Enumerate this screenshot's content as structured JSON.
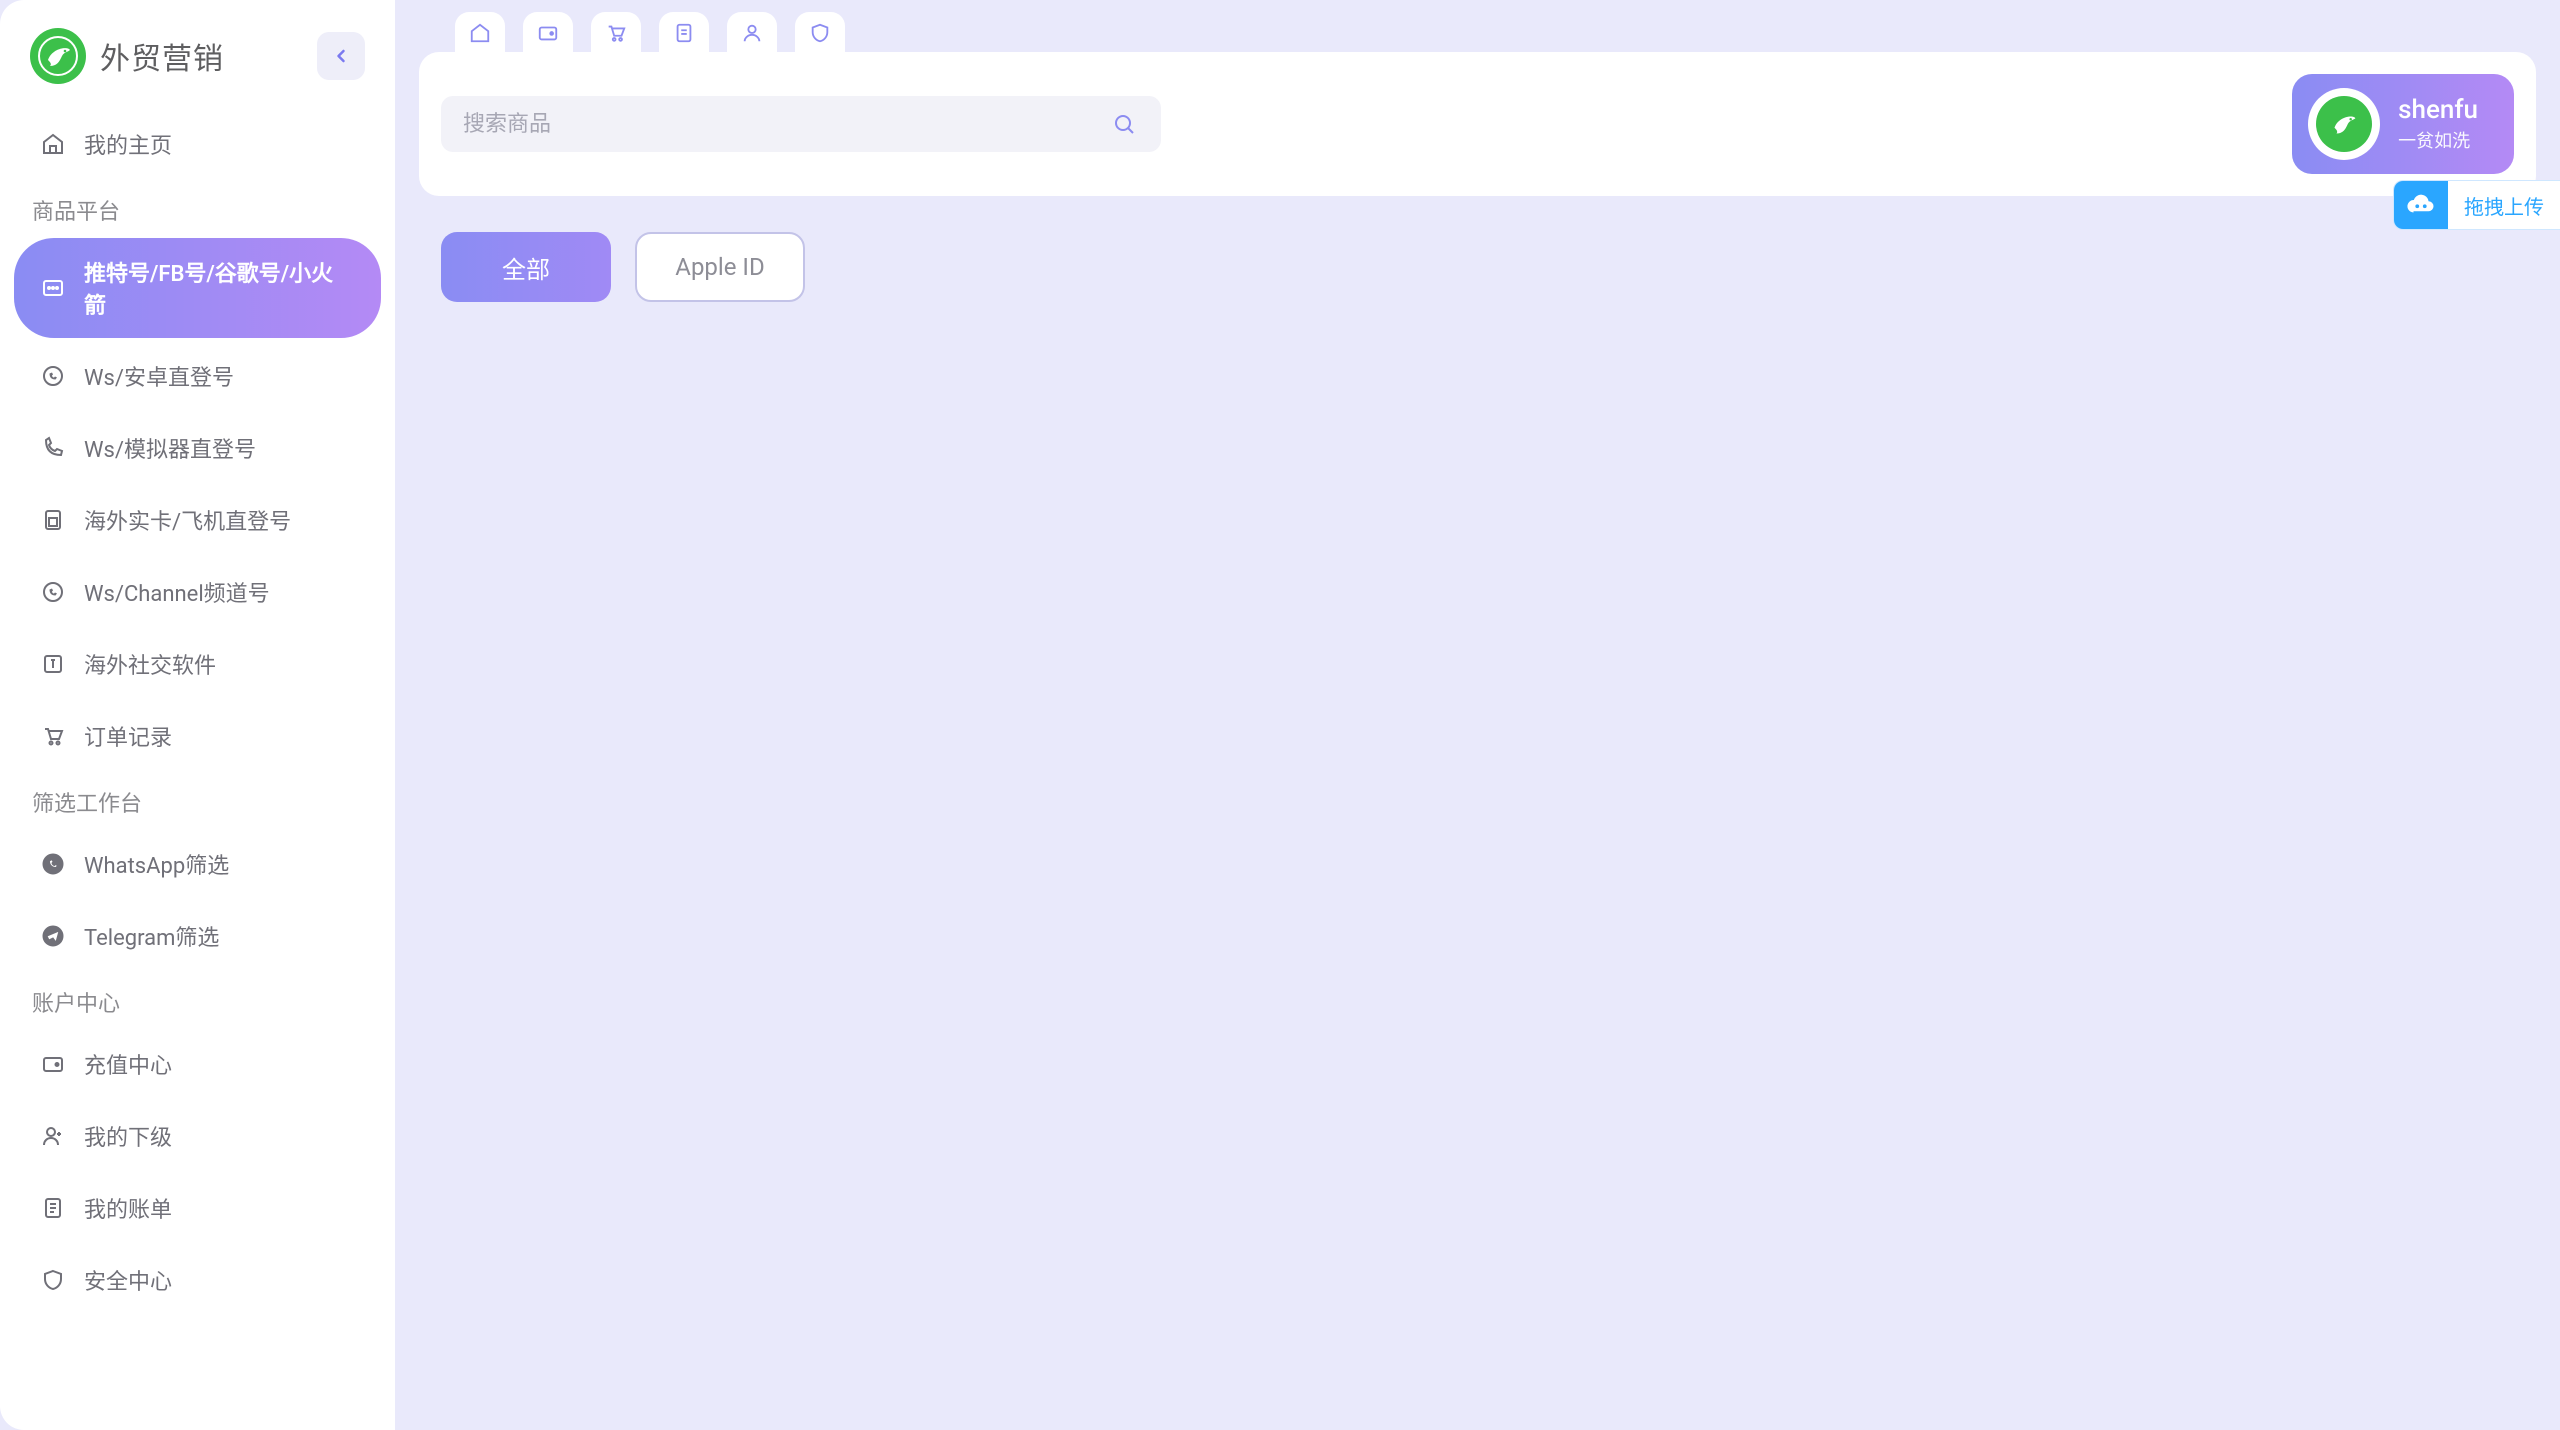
{
  "brand": {
    "title": "外贸营销"
  },
  "sidebar": {
    "top_item": {
      "label": "我的主页"
    },
    "sections": [
      {
        "title": "商品平台",
        "items": [
          {
            "label": "推特号/FB号/谷歌号/小火箭",
            "icon": "chat-icon",
            "active": true
          },
          {
            "label": "Ws/安卓直登号",
            "icon": "whatsapp-icon"
          },
          {
            "label": "Ws/模拟器直登号",
            "icon": "phone-icon"
          },
          {
            "label": "海外实卡/飞机直登号",
            "icon": "sim-icon"
          },
          {
            "label": "Ws/Channel频道号",
            "icon": "whatsapp-icon"
          },
          {
            "label": "海外社交软件",
            "icon": "social-icon"
          },
          {
            "label": "订单记录",
            "icon": "cart-icon"
          }
        ]
      },
      {
        "title": "筛选工作台",
        "items": [
          {
            "label": "WhatsApp筛选",
            "icon": "whatsapp-filled-icon"
          },
          {
            "label": "Telegram筛选",
            "icon": "telegram-icon"
          }
        ]
      },
      {
        "title": "账户中心",
        "items": [
          {
            "label": "充值中心",
            "icon": "wallet-icon"
          },
          {
            "label": "我的下级",
            "icon": "user-plus-icon"
          },
          {
            "label": "我的账单",
            "icon": "bill-icon"
          },
          {
            "label": "安全中心",
            "icon": "shield-icon"
          }
        ]
      }
    ]
  },
  "top_tabs": [
    {
      "icon": "home-icon"
    },
    {
      "icon": "wallet-tab-icon"
    },
    {
      "icon": "cart-tab-icon"
    },
    {
      "icon": "bill-tab-icon"
    },
    {
      "icon": "user-tab-icon"
    },
    {
      "icon": "shield-tab-icon"
    }
  ],
  "search": {
    "placeholder": "搜索商品"
  },
  "user": {
    "name": "shenfu",
    "subtitle": "一贫如洗"
  },
  "filters": [
    {
      "label": "全部",
      "style": "primary"
    },
    {
      "label": "Apple ID",
      "style": "outline"
    }
  ],
  "upload_widget": {
    "label": "拖拽上传"
  }
}
